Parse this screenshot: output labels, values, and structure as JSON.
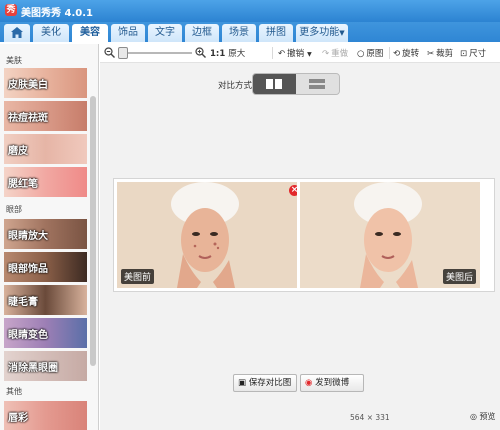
{
  "window": {
    "title": "美图秀秀 4.0.1",
    "logo_text": "秀"
  },
  "tabs": [
    {
      "label": "美化"
    },
    {
      "label": "美容",
      "active": true
    },
    {
      "label": "饰品"
    },
    {
      "label": "文字"
    },
    {
      "label": "边框"
    },
    {
      "label": "场景"
    },
    {
      "label": "拼图"
    },
    {
      "label": "更多功能"
    }
  ],
  "sidebar": {
    "categories": [
      {
        "label": "美肤"
      },
      {
        "label": "眼部"
      },
      {
        "label": "其他"
      }
    ],
    "items": [
      {
        "label": "皮肤美白"
      },
      {
        "label": "祛痘祛斑"
      },
      {
        "label": "磨皮"
      },
      {
        "label": "腮红笔"
      },
      {
        "label": "眼睛放大"
      },
      {
        "label": "眼部饰品"
      },
      {
        "label": "睫毛膏"
      },
      {
        "label": "眼睛变色"
      },
      {
        "label": "消除黑眼圈"
      },
      {
        "label": "唇彩"
      }
    ]
  },
  "toolbar": {
    "zoom_ratio": "1:1",
    "original_size_label": "原大",
    "undo_label": "撤销",
    "redo_label": "重做",
    "original_image_label": "原图",
    "rotate_label": "旋转",
    "crop_label": "裁剪",
    "resize_label": "尺寸"
  },
  "main": {
    "compare_mode_label": "对比方式",
    "before_tag": "美图前",
    "after_tag": "美图后",
    "save_compare_label": "保存对比图",
    "share_weibo_label": "发到微博",
    "image_size": "564 × 331",
    "preview_label": "预览"
  },
  "colors": {
    "titlebar": "#2c83d2",
    "active_tab": "#ffffff",
    "close_badge": "#e2292c"
  }
}
